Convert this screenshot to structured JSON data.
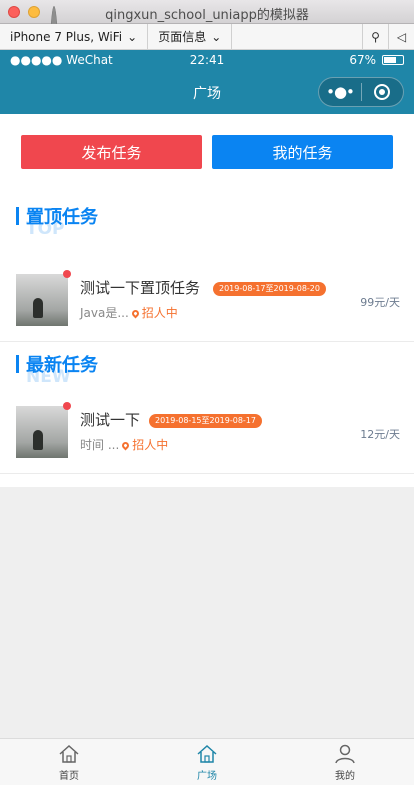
{
  "window": {
    "title": "qingxun_school_uniapp的模拟器"
  },
  "toolbar": {
    "device": "iPhone 7 Plus, WiFi",
    "page_info": "页面信息"
  },
  "statusbar": {
    "carrier": "●●●●● WeChat",
    "time": "22:41",
    "battery": "67%"
  },
  "navbar": {
    "title": "广场",
    "more": "•●•"
  },
  "actions": {
    "publish": "发布任务",
    "mine": "我的任务"
  },
  "sections": {
    "top": {
      "title": "置顶任务",
      "subtitle": "TOP"
    },
    "new": {
      "title": "最新任务",
      "subtitle": "NEW"
    }
  },
  "tasks": [
    {
      "title": "测试一下置顶任务",
      "dates": "2019-08-17至2019-08-20",
      "desc": "Java是...",
      "status": "招人中",
      "price": "99元/天"
    },
    {
      "title": "测试一下",
      "dates": "2019-08-15至2019-08-17",
      "desc": "时间 ...",
      "status": "招人中",
      "price": "12元/天"
    }
  ],
  "tabbar": {
    "items": [
      {
        "label": "首页"
      },
      {
        "label": "广场"
      },
      {
        "label": "我的"
      }
    ],
    "active": 1
  },
  "colors": {
    "brand": "#1f86a8",
    "red": "#f0474e",
    "blue": "#0a84f2",
    "orange": "#f5712f"
  }
}
